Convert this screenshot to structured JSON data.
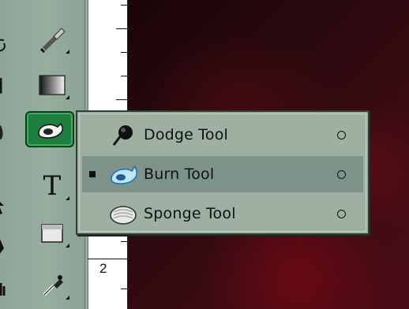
{
  "toolbox": {
    "tools": [
      {
        "name": "history-brush-tool",
        "icon": "brush-icon",
        "state": "normal"
      },
      {
        "name": "gradient-tool",
        "icon": "gradient-icon",
        "state": "normal"
      },
      {
        "name": "burn-tool",
        "icon": "burn-hand-icon",
        "state": "selected"
      },
      {
        "name": "type-tool",
        "icon": "type-T-icon",
        "state": "normal",
        "glyph": "T"
      },
      {
        "name": "notes-tool",
        "icon": "note-icon",
        "state": "normal"
      },
      {
        "name": "eyedropper-tool",
        "icon": "eyedropper-icon",
        "state": "normal"
      }
    ]
  },
  "ruler": {
    "number": "2"
  },
  "flyout": {
    "items": [
      {
        "label": "Dodge Tool",
        "icon": "dodge-icon",
        "active": false,
        "shortcut_icon": "circle-icon"
      },
      {
        "label": "Burn Tool",
        "icon": "burn-icon",
        "active": true,
        "shortcut_icon": "circle-icon"
      },
      {
        "label": "Sponge Tool",
        "icon": "sponge-icon",
        "active": false,
        "shortcut_icon": "circle-icon"
      }
    ]
  },
  "colors": {
    "toolbox_bg": "#97ae9f",
    "selected_tool": "#1f7f41",
    "menu_bg": "#9db0a1",
    "menu_active": "#7e948a",
    "canvas": "#2b0a0f"
  }
}
